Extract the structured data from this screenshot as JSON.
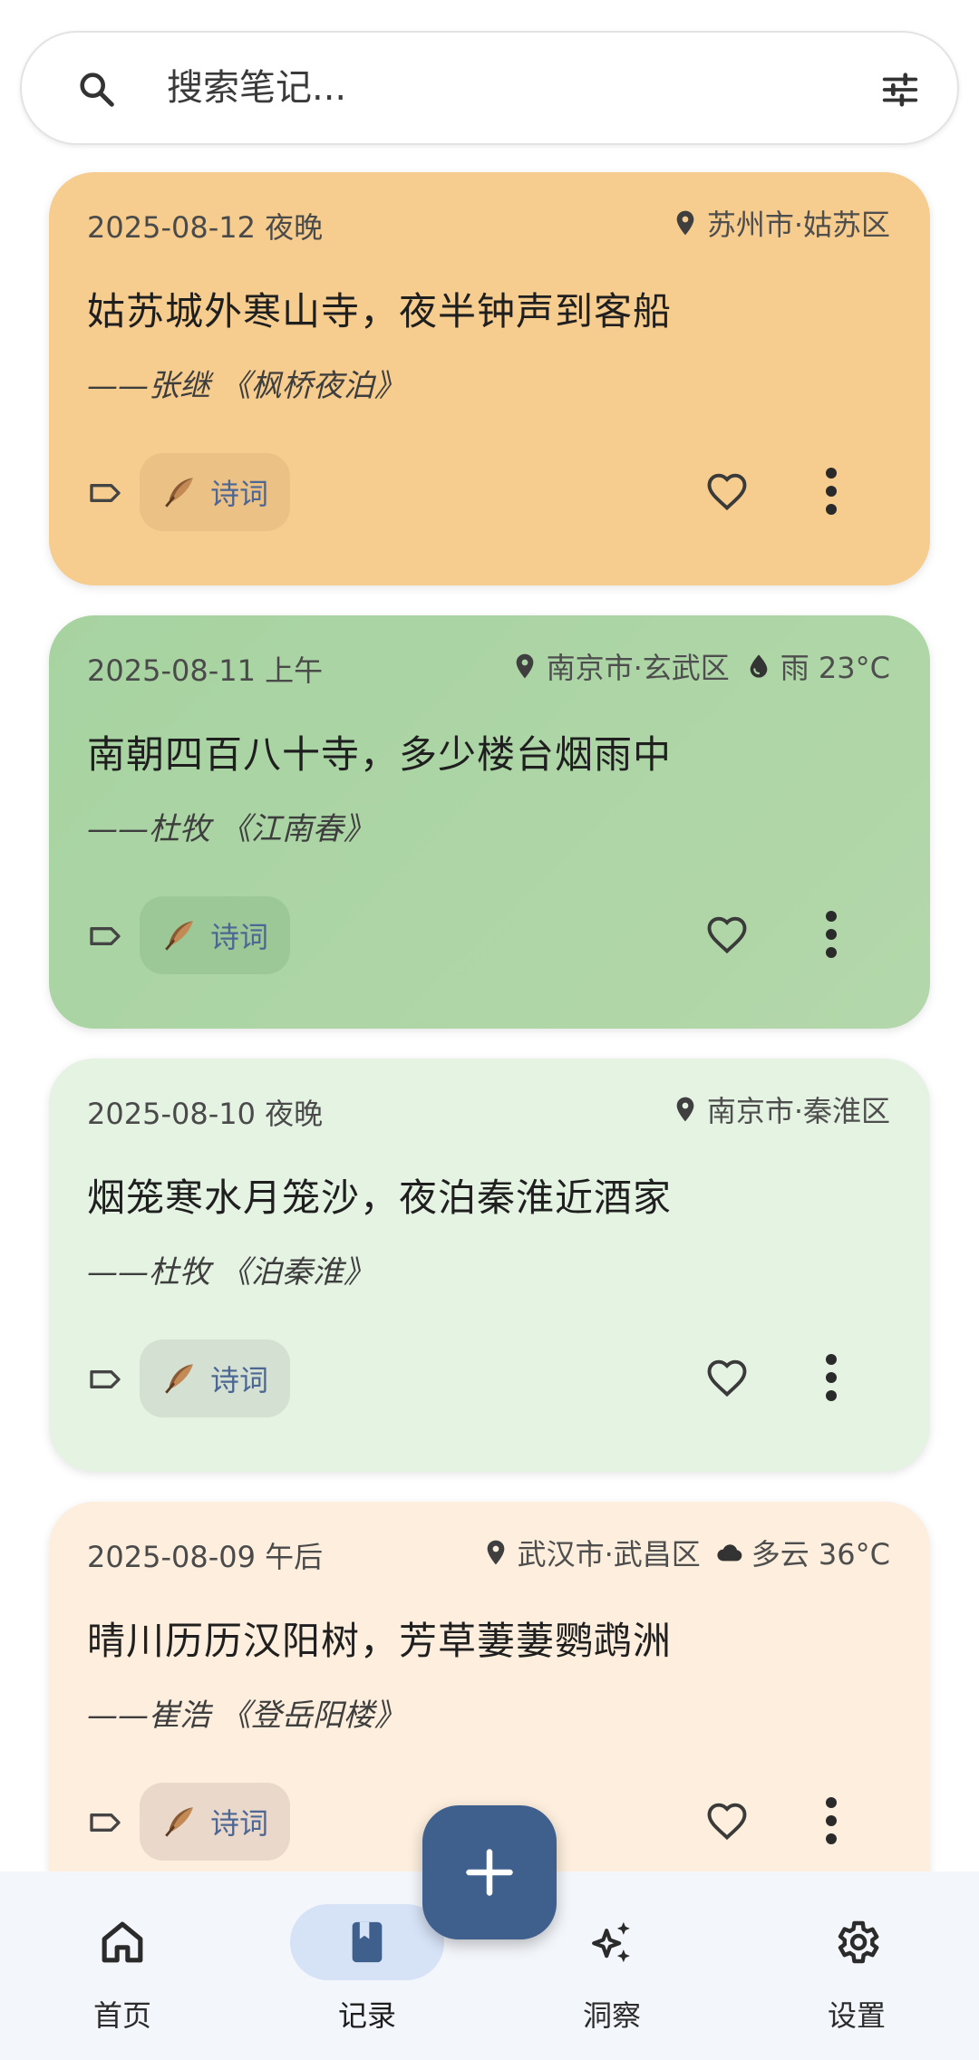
{
  "search": {
    "placeholder": "搜索笔记..."
  },
  "colors": {
    "accent": "#3f5f8d",
    "chip_text": "#4d6794",
    "nav_active_bg": "#d6e2f6"
  },
  "notes": [
    {
      "date": "2025-08-12 夜晚",
      "location": "苏州市·姑苏区",
      "weather": "",
      "line": "姑苏城外寒山寺，夜半钟声到客船",
      "source": "——张继 《枫桥夜泊》",
      "tag": "诗词",
      "color": "#f6cd8f"
    },
    {
      "date": "2025-08-11 上午",
      "location": "南京市·玄武区",
      "weather": "雨 23°C",
      "line": "南朝四百八十寺，多少楼台烟雨中",
      "source": "——杜牧 《江南春》",
      "tag": "诗词",
      "color": "#a7d3a1"
    },
    {
      "date": "2025-08-10 夜晚",
      "location": "南京市·秦淮区",
      "weather": "",
      "line": "烟笼寒水月笼沙，夜泊秦淮近酒家",
      "source": "——杜牧 《泊秦淮》",
      "tag": "诗词",
      "color": "#e5f3e3"
    },
    {
      "date": "2025-08-09 午后",
      "location": "武汉市·武昌区",
      "weather": "多云 36°C",
      "line": "晴川历历汉阳树，芳草萋萋鹦鹉洲",
      "source": "——崔浩 《登岳阳楼》",
      "tag": "诗词",
      "color": "#fdeedd"
    }
  ],
  "icons": {
    "location": "location-pin-icon",
    "rain": "water-drop-icon",
    "cloudy": "cloud-icon",
    "tag": "tag-outline-icon",
    "feather": "feather-icon",
    "like": "heart-outline-icon",
    "more": "more-vert-icon"
  },
  "nav": {
    "items": [
      {
        "label": "首页",
        "icon": "home-icon",
        "active": false
      },
      {
        "label": "记录",
        "icon": "bookmark-book-icon",
        "active": true
      },
      {
        "label": "洞察",
        "icon": "sparkles-icon",
        "active": false
      },
      {
        "label": "设置",
        "icon": "gear-icon",
        "active": false
      }
    ]
  },
  "fab": {
    "icon": "plus-icon"
  }
}
